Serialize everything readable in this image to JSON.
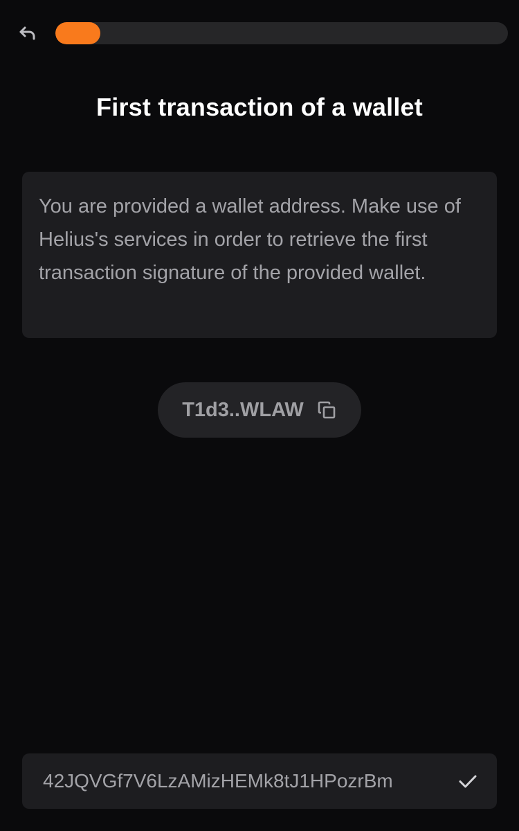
{
  "header": {
    "back_icon": "undo-arrow-icon",
    "progress_fraction": 0.1,
    "progress_color": "#f97a1c"
  },
  "title": "First transaction of a wallet",
  "description": "You are provided a wallet address. Make use of Helius's services in order to retrieve the first transaction signature of the provided wallet.",
  "wallet_chip": {
    "address": "T1d3..WLAW",
    "icon": "copy-icon"
  },
  "answer": {
    "value": "42JQVGf7V6LzAMizHEMk8tJ1HPozrBm",
    "submit_icon": "check-icon"
  }
}
